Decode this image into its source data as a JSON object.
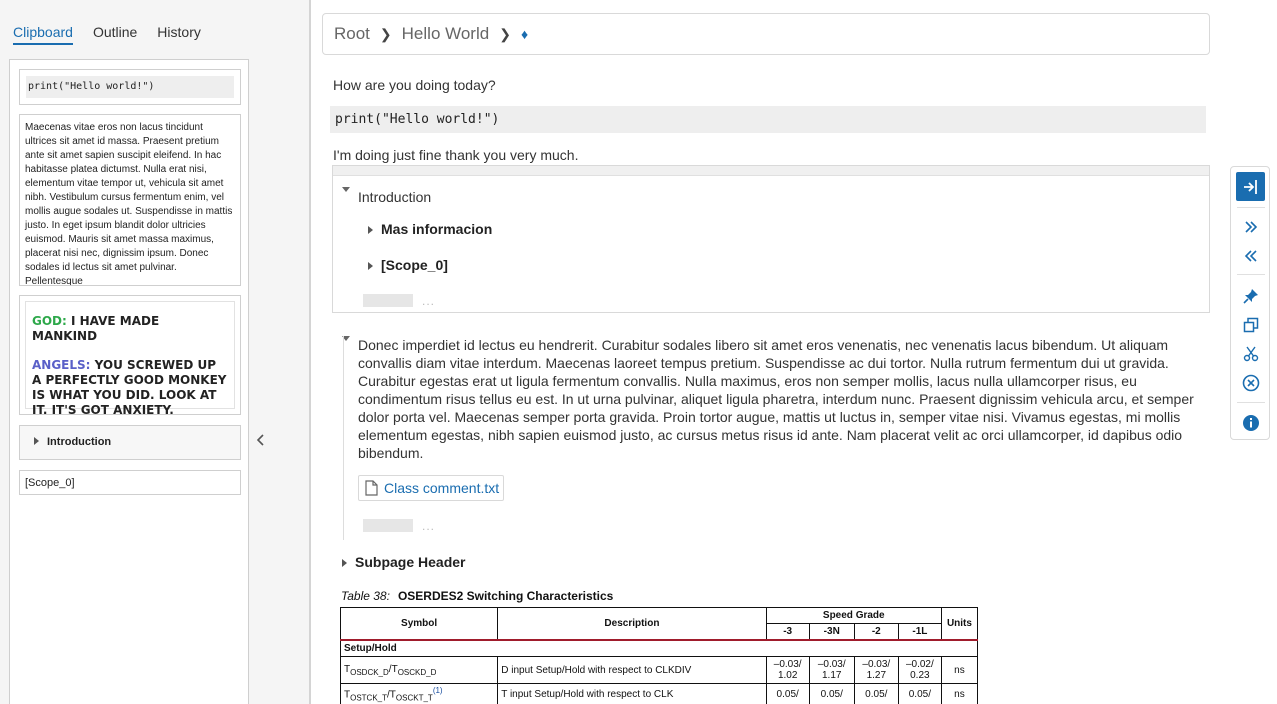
{
  "left_panel": {
    "tabs": [
      {
        "label": "Clipboard",
        "active": true
      },
      {
        "label": "Outline",
        "active": false
      },
      {
        "label": "History",
        "active": false
      }
    ],
    "clipboard": {
      "code_snippet": "print(\"Hello world!\")",
      "lorem_text": "Maecenas vitae eros non lacus tincidunt ultrices sit amet id massa. Praesent pretium ante sit amet sapien suscipit eleifend. In hac habitasse platea dictumst. Nulla erat nisi, elementum vitae tempor ut, vehicula sit amet nibh. Vestibulum cursus fermentum enim, vel mollis augue sodales ut. Suspendisse in mattis justo. In eget ipsum blandit dolor ultricies euismod. Mauris sit amet massa maximus, placerat nisi nec, dignissim ipsum. Donec sodales id lectus sit amet pulvinar. Pellentesque",
      "comic": {
        "speaker1": "GOD:",
        "line1": " I HAVE MADE MANKIND",
        "speaker2": "ANGELS:",
        "line2": " YOU SCREWED UP A PERFECTLY GOOD MONKEY IS WHAT YOU DID. LOOK AT IT. IT'S GOT ANXIETY."
      },
      "intro_label": "Introduction",
      "scope_label": "[Scope_0]"
    }
  },
  "breadcrumb": {
    "items": [
      "Root",
      "Hello World"
    ],
    "current_icon": "diamond-icon"
  },
  "main": {
    "greeting": "How are you doing today?",
    "code": "print(\"Hello world!\")",
    "reply": "I'm doing just fine thank you very much.",
    "intro_section": {
      "title": "Introduction",
      "children": [
        "Mas informacion",
        "[Scope_0]"
      ]
    },
    "paragraph": "Donec imperdiet id lectus eu hendrerit. Curabitur sodales libero sit amet eros venenatis, nec venenatis lacus bibendum. Ut aliquam convallis diam vitae interdum. Maecenas laoreet tempus pretium. Suspendisse ac dui tortor. Nulla rutrum fermentum dui ut gravida. Curabitur egestas erat ut ligula fermentum convallis. Nulla maximus, eros non semper mollis, lacus nulla ullamcorper risus, eu condimentum risus tellus eu est. In ut urna pulvinar, aliquet ligula pharetra, interdum nunc. Praesent dignissim vehicula arcu, et semper dolor porta vel. Maecenas semper porta gravida. Proin tortor augue, mattis ut luctus in, semper vitae nisi. Vivamus egestas, mi mollis elementum egestas, nibh sapien euismod justo, ac cursus metus risus id ante. Nam placerat velit ac orci ullamcorper, id dapibus odio bibendum.",
    "attachment": "Class comment.txt",
    "ellipsis": "...",
    "subpage_header": "Subpage Header",
    "table": {
      "caption_num": "Table  38:",
      "caption_title": "OSERDES2 Switching Characteristics",
      "col_symbol": "Symbol",
      "col_description": "Description",
      "col_speed": "Speed Grade",
      "col_units": "Units",
      "grades": [
        "-3",
        "-3N",
        "-2",
        "-1L"
      ],
      "section": "Setup/Hold",
      "row1": {
        "symbol_main": "T",
        "symbol_sub1": "OSDCK_D",
        "symbol_slash": "/T",
        "symbol_sub2": "OSCKD_D",
        "description": "D input Setup/Hold with respect to CLKDIV",
        "values": [
          "–0.03/ 1.02",
          "–0.03/ 1.17",
          "–0.03/ 1.27",
          "–0.02/ 0.23"
        ],
        "unit": "ns"
      },
      "row2": {
        "symbol_main": "T",
        "symbol_sub1": "OSTCK_T",
        "symbol_slash": "/T",
        "symbol_sub2": "OSCKT_T",
        "footnote": "(1)",
        "description": "T input Setup/Hold with respect to CLK",
        "values": [
          "0.05/",
          "0.05/",
          "0.05/",
          "0.05/"
        ],
        "unit": "ns"
      }
    }
  },
  "toolbar": {
    "buttons": [
      "enter-icon",
      "expand-all-icon",
      "collapse-all-icon",
      "pin-icon",
      "copy-icon",
      "cut-icon",
      "remove-icon",
      "info-icon"
    ]
  },
  "colors": {
    "accent": "#1a6db0",
    "god": "#2da84a",
    "angels": "#5a60c8",
    "table_rule": "#a01c2c"
  }
}
